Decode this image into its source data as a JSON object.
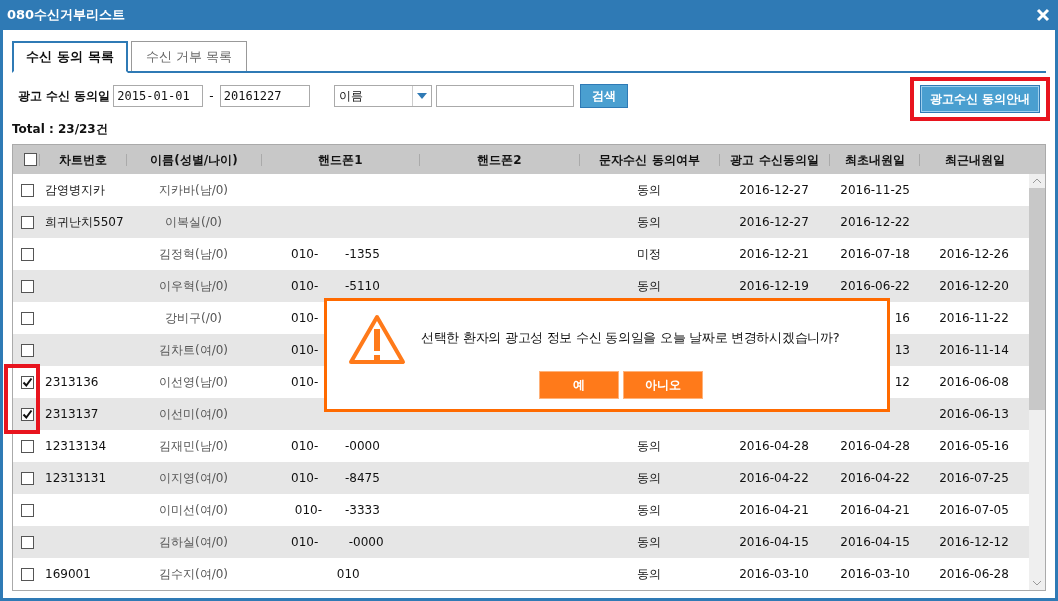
{
  "window": {
    "title": "080수신거부리스트"
  },
  "tabs": [
    {
      "label": "수신 동의 목록",
      "selected": true
    },
    {
      "label": "수신 거부 목록",
      "selected": false
    }
  ],
  "filter": {
    "label": "광고 수신 동의일",
    "date_from": "2015-01-01",
    "separator": "-",
    "date_to": "20161227",
    "search_type": "이름",
    "search_button": "검색",
    "guide_button": "광고수신 동의안내"
  },
  "total": "Total : 23/23건",
  "table": {
    "header_checked": false,
    "columns": [
      "차트번호",
      "이름(성별/나이)",
      "핸드폰1",
      "핸드폰2",
      "문자수신 동의여부",
      "광고 수신동의일",
      "최초내원일",
      "최근내원일"
    ],
    "rows": [
      {
        "checked": false,
        "chart_no": "감영병지카",
        "name": "지카바(남/0)",
        "phone1": "",
        "consent": "동의",
        "ad_date": "2016-12-27",
        "first_visit": "2016-11-25",
        "last_visit": ""
      },
      {
        "checked": false,
        "chart_no": "희귀난치5507",
        "name": "이복실(/0)",
        "phone1": "",
        "consent": "동의",
        "ad_date": "2016-12-27",
        "first_visit": "2016-12-22",
        "last_visit": ""
      },
      {
        "checked": false,
        "chart_no": "",
        "name": "김정혁(남/0)",
        "phone1": "010-       -1355",
        "consent": "미정",
        "ad_date": "2016-12-21",
        "first_visit": "2016-07-18",
        "last_visit": "2016-12-26"
      },
      {
        "checked": false,
        "chart_no": "",
        "name": "이우혁(남/0)",
        "phone1": "010-       -5110",
        "consent": "동의",
        "ad_date": "2016-12-19",
        "first_visit": "2016-06-22",
        "last_visit": "2016-12-20"
      },
      {
        "checked": false,
        "chart_no": "",
        "name": "강비구(/0)",
        "phone1": "010-",
        "consent": "",
        "ad_date": "",
        "first_visit": "16",
        "last_visit": "2016-11-22"
      },
      {
        "checked": false,
        "chart_no": "",
        "name": "김차트(여/0)",
        "phone1": "010-",
        "consent": "",
        "ad_date": "",
        "first_visit": "13",
        "last_visit": "2016-11-14"
      },
      {
        "checked": true,
        "chart_no": "2313136",
        "name": "이선영(남/0)",
        "phone1": "010-",
        "consent": "",
        "ad_date": "",
        "first_visit": "12",
        "last_visit": "2016-06-08"
      },
      {
        "checked": true,
        "chart_no": "2313137",
        "name": "이선미(여/0)",
        "phone1": "",
        "consent": "",
        "ad_date": "",
        "first_visit": "",
        "last_visit": "2016-06-13"
      },
      {
        "checked": false,
        "chart_no": "12313134",
        "name": "김재민(남/0)",
        "phone1": "010-       -0000",
        "consent": "동의",
        "ad_date": "2016-04-28",
        "first_visit": "2016-04-28",
        "last_visit": "2016-05-16"
      },
      {
        "checked": false,
        "chart_no": "12313131",
        "name": "이지영(여/0)",
        "phone1": "010-       -8475",
        "consent": "동의",
        "ad_date": "2016-04-22",
        "first_visit": "2016-04-22",
        "last_visit": "2016-07-25"
      },
      {
        "checked": false,
        "chart_no": "",
        "name": "이미선(여/0)",
        "phone1": " 010-      -3333",
        "consent": "동의",
        "ad_date": "2016-04-21",
        "first_visit": "2016-04-21",
        "last_visit": "2016-07-05"
      },
      {
        "checked": false,
        "chart_no": "",
        "name": "김하실(여/0)",
        "phone1": "010-        -0000",
        "consent": "동의",
        "ad_date": "2016-04-15",
        "first_visit": "2016-04-15",
        "last_visit": "2016-12-12"
      },
      {
        "checked": false,
        "chart_no": "169001",
        "name": "김수지(여/0)",
        "phone1": "            010",
        "consent": "동의",
        "ad_date": "2016-03-10",
        "first_visit": "2016-03-10",
        "last_visit": "2016-06-28"
      }
    ]
  },
  "dialog": {
    "message": "선택한 환자의 광고성 정보 수신 동의일을 오늘 날짜로 변경하시겠습니까?",
    "buttons": [
      "예",
      "아니오"
    ]
  }
}
